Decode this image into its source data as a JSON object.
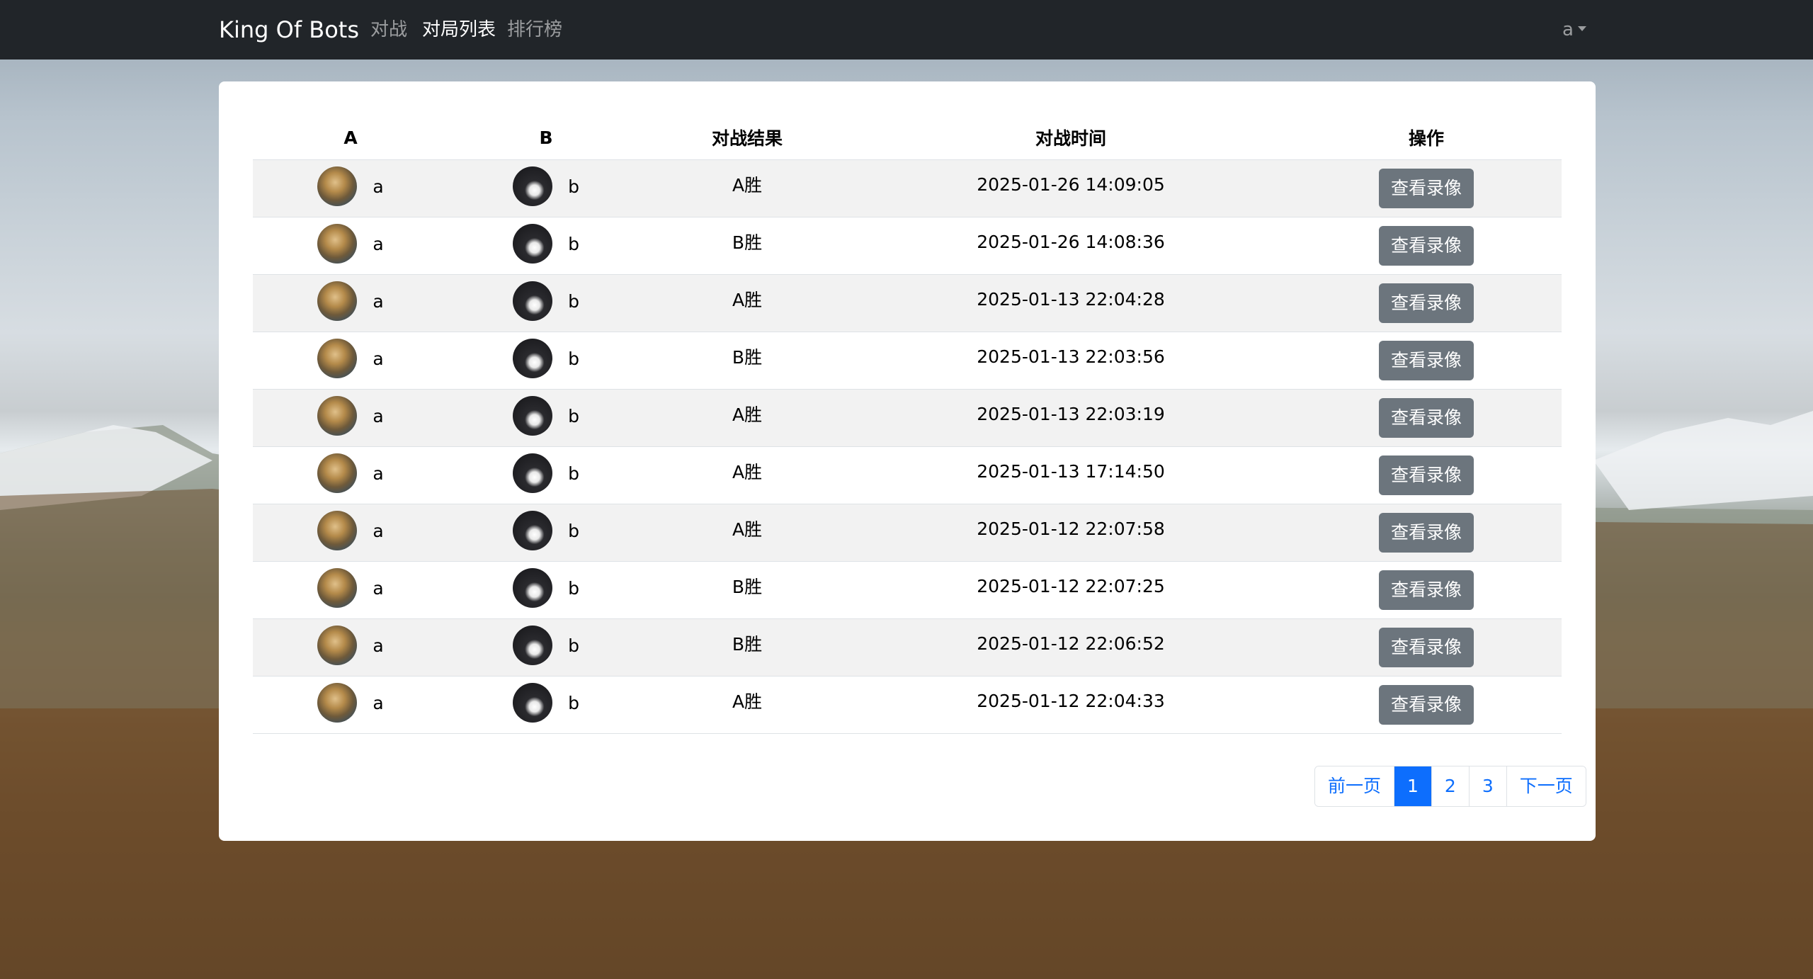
{
  "navbar": {
    "brand": "King Of Bots",
    "links": [
      {
        "label": "对战"
      },
      {
        "label": "对局列表"
      },
      {
        "label": "排行榜"
      }
    ],
    "user": "a"
  },
  "table": {
    "headers": [
      "A",
      "B",
      "对战结果",
      "对战时间",
      "操作"
    ],
    "rows": [
      {
        "a_name": "a",
        "b_name": "b",
        "result": "A胜",
        "time": "2025-01-26 14:09:05",
        "action": "查看录像"
      },
      {
        "a_name": "a",
        "b_name": "b",
        "result": "B胜",
        "time": "2025-01-26 14:08:36",
        "action": "查看录像"
      },
      {
        "a_name": "a",
        "b_name": "b",
        "result": "A胜",
        "time": "2025-01-13 22:04:28",
        "action": "查看录像"
      },
      {
        "a_name": "a",
        "b_name": "b",
        "result": "B胜",
        "time": "2025-01-13 22:03:56",
        "action": "查看录像"
      },
      {
        "a_name": "a",
        "b_name": "b",
        "result": "A胜",
        "time": "2025-01-13 22:03:19",
        "action": "查看录像"
      },
      {
        "a_name": "a",
        "b_name": "b",
        "result": "A胜",
        "time": "2025-01-13 17:14:50",
        "action": "查看录像"
      },
      {
        "a_name": "a",
        "b_name": "b",
        "result": "A胜",
        "time": "2025-01-12 22:07:58",
        "action": "查看录像"
      },
      {
        "a_name": "a",
        "b_name": "b",
        "result": "B胜",
        "time": "2025-01-12 22:07:25",
        "action": "查看录像"
      },
      {
        "a_name": "a",
        "b_name": "b",
        "result": "B胜",
        "time": "2025-01-12 22:06:52",
        "action": "查看录像"
      },
      {
        "a_name": "a",
        "b_name": "b",
        "result": "A胜",
        "time": "2025-01-12 22:04:33",
        "action": "查看录像"
      }
    ]
  },
  "pagination": {
    "prev": "前一页",
    "pages": [
      "1",
      "2",
      "3"
    ],
    "current": "1",
    "next": "下一页"
  },
  "colors": {
    "navbar_bg": "#212529",
    "accent": "#0d6efd",
    "button_bg": "#6c757d"
  }
}
